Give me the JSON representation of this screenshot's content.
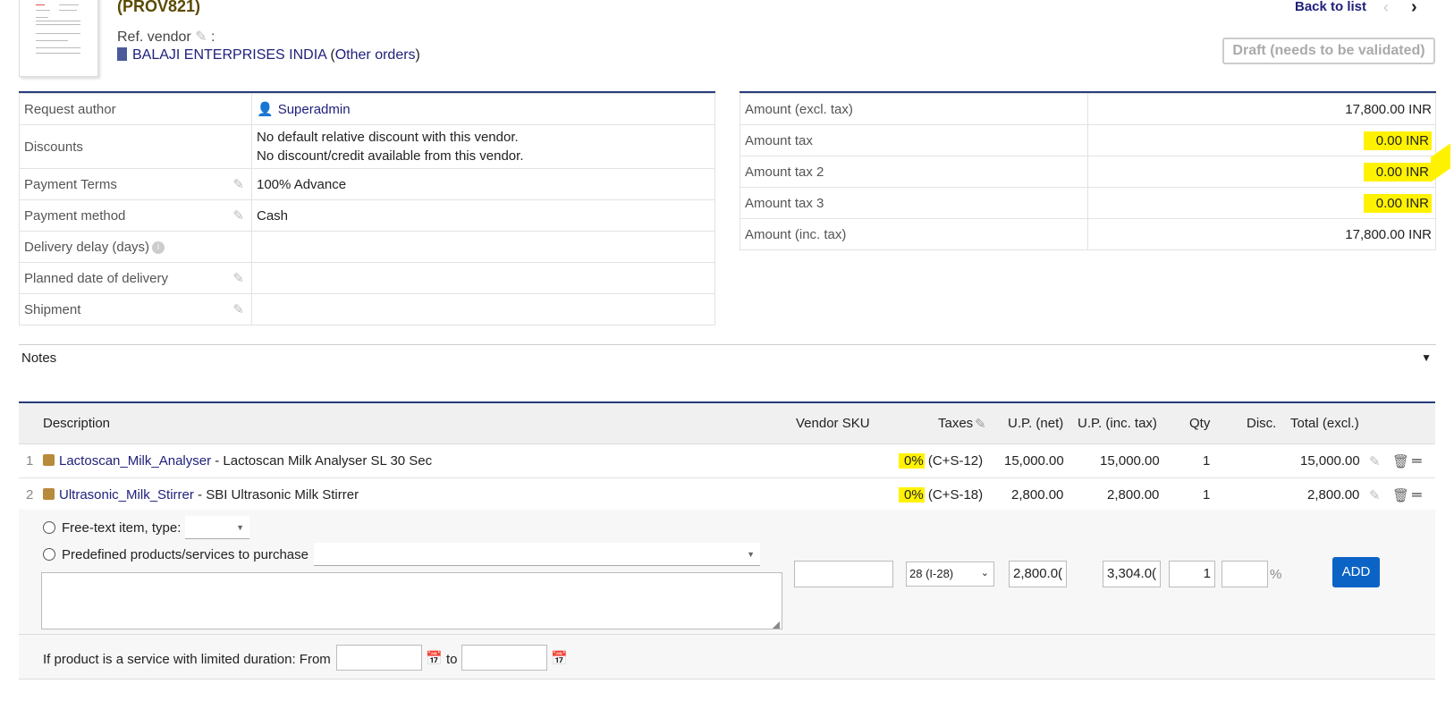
{
  "header": {
    "ref": "(PROV821)",
    "ref_vendor_label": "Ref. vendor",
    "ref_vendor_colon": ":",
    "vendor_name": "BALAJI ENTERPRISES INDIA",
    "other_orders": "Other orders",
    "back_to_list": "Back to list",
    "status": "Draft (needs to be validated)"
  },
  "details": {
    "request_author_label": "Request author",
    "request_author_value": "Superadmin",
    "discounts_label": "Discounts",
    "discount_line1": "No default relative discount with this vendor.",
    "discount_line2": "No discount/credit available from this vendor.",
    "payment_terms_label": "Payment Terms",
    "payment_terms_value": "100% Advance",
    "payment_method_label": "Payment method",
    "payment_method_value": "Cash",
    "delivery_delay_label": "Delivery delay (days)",
    "planned_date_label": "Planned date of delivery",
    "shipment_label": "Shipment"
  },
  "amounts": {
    "excl_label": "Amount (excl. tax)",
    "excl_value": "17,800.00 INR",
    "tax_label": "Amount tax",
    "tax_value": "0.00 INR",
    "tax2_label": "Amount tax 2",
    "tax2_value": "0.00 INR",
    "tax3_label": "Amount tax 3",
    "tax3_value": "0.00 INR",
    "inc_label": "Amount (inc. tax)",
    "inc_value": "17,800.00 INR"
  },
  "notes": {
    "label": "Notes"
  },
  "lines": {
    "headers": {
      "description": "Description",
      "vendor_sku": "Vendor SKU",
      "taxes": "Taxes",
      "up_net": "U.P. (net)",
      "up_inc": "U.P. (inc. tax)",
      "qty": "Qty",
      "disc": "Disc.",
      "total": "Total (excl.)"
    },
    "rows": [
      {
        "num": "1",
        "ref": "Lactoscan_Milk_Analyser",
        "desc": " - Lactoscan Milk Analyser SL 30 Sec",
        "tax_pct": "0%",
        "tax_code": " (C+S-12)",
        "up_net": "15,000.00",
        "up_inc": "15,000.00",
        "qty": "1",
        "total": "15,000.00"
      },
      {
        "num": "2",
        "ref": "Ultrasonic_Milk_Stirrer",
        "desc": " - SBI Ultrasonic Milk Stirrer",
        "tax_pct": "0%",
        "tax_code": " (C+S-18)",
        "up_net": "2,800.00",
        "up_inc": "2,800.00",
        "qty": "1",
        "total": "2,800.00"
      }
    ]
  },
  "add_form": {
    "free_text_label": "Free-text item, type:",
    "predefined_label": "Predefined products/services to purchase",
    "tax_select": "28 (I-28)",
    "up_net": "2,800.0(",
    "up_inc": "3,304.0(",
    "qty": "1",
    "percent": "%",
    "add_button": "ADD",
    "service_label": "If product is a service with limited duration: From",
    "to_label": "to"
  }
}
